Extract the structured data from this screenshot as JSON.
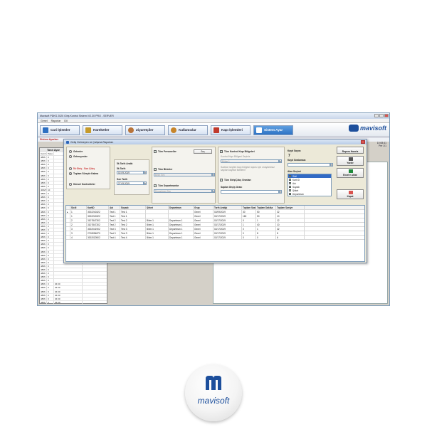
{
  "app": {
    "title": "Mavisoft PDKS 2020 Giriş Kontrol Sistemi V2.30 PRO - SERVER",
    "menu": [
      "Genel",
      "Raporlar",
      "Dil"
    ],
    "toolbar": [
      {
        "label": "Cari İşlemler",
        "icon": "document-icon",
        "color": "#2d6fc2"
      },
      {
        "label": "Hareketler",
        "icon": "arrows-icon",
        "color": "#c69a2a"
      },
      {
        "label": "Ziyaretçiler",
        "icon": "person-icon",
        "color": "#b8743a"
      },
      {
        "label": "Kullanıcılar",
        "icon": "user-icon",
        "color": "#c7852a"
      },
      {
        "label": "Kapı İşlemleri",
        "icon": "door-icon",
        "color": "#c0392b"
      },
      {
        "label": "Sistem Ayar",
        "icon": "settings-icon",
        "color": "#2e72c4"
      }
    ],
    "brand": "mavisoft",
    "clock": {
      "time": "10:08:41",
      "day": "Per 1/1"
    },
    "sysbar": "Sistem Ayarları",
    "left_header": "Tanıt Ayar",
    "left_columns": [
      "Cari No",
      "Pano No",
      ""
    ],
    "left_rows": [
      [
        "4806",
        "0",
        ""
      ],
      [
        "4806",
        "0",
        ""
      ],
      [
        "4806",
        "0",
        ""
      ],
      [
        "4806",
        "0",
        ""
      ],
      [
        "4806",
        "0",
        ""
      ],
      [
        "4806",
        "0",
        ""
      ],
      [
        "4806",
        "0",
        ""
      ],
      [
        "4806",
        "0",
        ""
      ],
      [
        "4806",
        "0",
        ""
      ],
      [
        "40627",
        "10",
        ""
      ],
      [
        "4806",
        "0",
        ""
      ],
      [
        "4806",
        "0",
        ""
      ],
      [
        "4806",
        "0",
        ""
      ],
      [
        "4806",
        "0",
        ""
      ],
      [
        "4806",
        "0",
        ""
      ],
      [
        "4806",
        "0",
        ""
      ],
      [
        "4806",
        "0",
        ""
      ],
      [
        "4806",
        "0",
        ""
      ],
      [
        "4806",
        "0",
        ""
      ],
      [
        "4806",
        "0",
        ""
      ],
      [
        "4806",
        "0",
        ""
      ],
      [
        "4806",
        "0",
        ""
      ],
      [
        "4806",
        "0",
        ""
      ],
      [
        "4806",
        "0",
        ""
      ],
      [
        "4806",
        "0",
        ""
      ],
      [
        "4806",
        "0",
        ""
      ],
      [
        "4806",
        "0",
        ""
      ],
      [
        "4806",
        "0",
        ""
      ],
      [
        "4806",
        "0",
        ""
      ],
      [
        "4806",
        "0",
        ""
      ],
      [
        "4806",
        "0",
        ""
      ],
      [
        "4806",
        "0",
        ""
      ],
      [
        "4806",
        "0",
        ""
      ],
      [
        "4806",
        "0",
        ""
      ],
      [
        "4806",
        "0",
        ""
      ],
      [
        "4806",
        "0",
        "04:30"
      ],
      [
        "4806",
        "0",
        "04:30"
      ],
      [
        "4806",
        "0",
        "04:30"
      ],
      [
        "4806",
        "0",
        "04:30"
      ],
      [
        "4806",
        "0",
        "04:30"
      ],
      [
        "4806",
        "0",
        "04:30"
      ]
    ]
  },
  "dialog": {
    "title": "Geliş Gelmeyen ve Çalışma Raporları",
    "report_types": [
      "Gelenler",
      "Gelmeyenler",
      "İlk Giriş - Son Çıkış",
      "Toplam Süreyle Kalma",
      "Kimsel Kontrolörler"
    ],
    "report_selected": 3,
    "date_group": "İlk Tarih Aralık",
    "start_label": "İlk Tarih",
    "start_value": "02.09.2019",
    "end_label": "Son Tarih",
    "end_value": "27.09.2019",
    "all_staff": "Tüm Personeller",
    "staff_btn": "Seç",
    "all_units": "Tüm Birimler",
    "unit_placeholder": "Birim Seç",
    "all_departments": "Tüm Departmanlar",
    "department_placeholder": "Departman Seç",
    "all_doors": "Tüm Kontrol Kapı Bölgeleri",
    "door_hint": "Kontrol Kapı Bölgesi Seçiniz",
    "door_select": "Bölge 1",
    "door_note": "Sadece seçilen kapı bölgesi raporu için onaylanmaz sayılan kayıtlar listelenir",
    "all_shift": "Tüm Giriş/Çıkış Oranları",
    "in_out_order": "Saplan Geçiş Oranı",
    "report_print": "Kayıt Sayısı",
    "report_print_value": "7",
    "record_sort": "Kayıt Sıralaması",
    "fields_label": "Alan Seçimi",
    "fields": [
      "Sicil",
      "Kart ID",
      "Adı",
      "Soyadı",
      "Şirket",
      "Departman"
    ],
    "fields_selected": 0,
    "btn_report": "Raporu Hazırla",
    "btn_print": "Yazdır",
    "btn_excel": "Excel'e Aktar",
    "btn_close": "Kapat",
    "table": {
      "columns": [
        "",
        "Sicili",
        "KartID",
        "Adı",
        "Soyadı",
        "Şirket",
        "Departman",
        "Grup",
        "Tarih Aralığı",
        "Toplam Saat",
        "Toplam Dakika",
        "Toplam Saniye"
      ],
      "rows": [
        [
          "▸",
          "1",
          "3002240322",
          "Test 1",
          "Test 1",
          "",
          "",
          "Genel",
          "02/09/2019",
          "30",
          "50",
          "32"
        ],
        [
          "",
          "1",
          "3002240322",
          "Test 1",
          "Test 1",
          "",
          "",
          "Genel",
          "02/17/2019",
          "160",
          "50",
          "10"
        ],
        [
          "",
          "2",
          "3107847302",
          "Test 2",
          "Test 2",
          "Birim 1",
          "Departman 1",
          "Genel",
          "02/17/2019",
          "0",
          "1",
          "12"
        ],
        [
          "",
          "2",
          "3107847302",
          "Test 2",
          "Test 2",
          "Birim 1",
          "Departman 1",
          "Genel",
          "02/17/2019",
          "1",
          "40",
          "10"
        ],
        [
          "",
          "3",
          "3002041902",
          "Test 3",
          "Test 3",
          "Birim 1",
          "Departman 1",
          "Genel",
          "02/17/2019",
          "0",
          "1",
          "32"
        ],
        [
          "",
          "3",
          "2718054870",
          "Test 3",
          "Test 3",
          "Birim 1",
          "Departman 1",
          "Genel",
          "02/17/2019",
          "0",
          "8",
          "8"
        ],
        [
          "",
          "4",
          "3002020502",
          "Test 4",
          "Test 4",
          "Birim 1",
          "Departman 1",
          "Genel",
          "02/17/2019",
          "0",
          "0",
          "6"
        ]
      ]
    }
  },
  "logo_text": "mavisoft",
  "colors": {
    "brand": "#1d4f9c",
    "accent": "#2e72c4",
    "danger": "#d9534f"
  }
}
